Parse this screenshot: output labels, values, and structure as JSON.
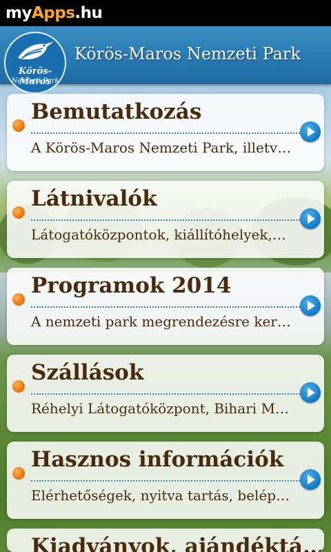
{
  "status_bar": {
    "brand_part1": "my",
    "brand_part2": "Apps",
    "brand_part3": ".hu"
  },
  "header": {
    "title": "Körös-Maros Nemzeti Park",
    "logo_line1": "Körös-Maros",
    "logo_line2": "Nemzeti Park"
  },
  "colors": {
    "header_blue": "#2a7ab3",
    "title_brown": "#4a2a0c",
    "bullet_orange": "#f07a10",
    "arrow_blue": "#1681cc",
    "brand_orange": "#f5a623"
  },
  "menu": [
    {
      "title": "Bemutatkozás",
      "desc": "A Körös-Maros Nemzeti Park, illetv…",
      "icon": "orange-bullet-icon",
      "arrow": "play-arrow-icon"
    },
    {
      "title": "Látnivalók",
      "desc": "Látogatóközpontok, kiállítóhelyek,…",
      "icon": "orange-bullet-icon",
      "arrow": "play-arrow-icon"
    },
    {
      "title": "Programok 2014",
      "desc": "A nemzeti park megrendezésre ker…",
      "icon": "orange-bullet-icon",
      "arrow": "play-arrow-icon"
    },
    {
      "title": "Szállások",
      "desc": "Réhelyi Látogatóközpont, Bihari M…",
      "icon": "orange-bullet-icon",
      "arrow": "play-arrow-icon"
    },
    {
      "title": "Hasznos információk",
      "desc": "Elérhetőségek, nyitva tartás, belép…",
      "icon": "orange-bullet-icon",
      "arrow": "play-arrow-icon"
    },
    {
      "title": "Kiadványok, ajándéktá…",
      "desc": "",
      "icon": "orange-bullet-icon",
      "arrow": "play-arrow-icon"
    }
  ]
}
